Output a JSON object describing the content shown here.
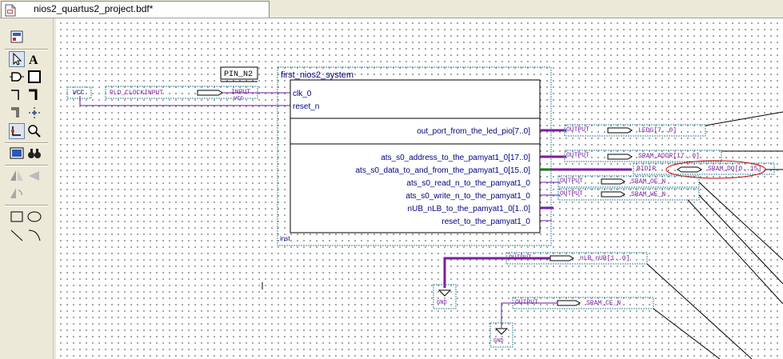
{
  "tab": {
    "title": "nios2_quartus2_project.bdf*",
    "icon": "bdf-file-icon"
  },
  "toolbar": {
    "tools": [
      "float-toolbar-icon",
      "selection-tool-icon",
      "text-tool-icon",
      "symbol-tool-icon",
      "block-tool-icon",
      "orthogonal-node-icon",
      "orthogonal-bus-icon",
      "conduit-icon",
      "rubberbanding-icon",
      "partial-line-select-icon",
      "zoom-icon",
      "full-screen-icon",
      "find-icon",
      "flip-horizontal-icon",
      "flip-vertical-icon",
      "rotate-icon",
      "rectangle-icon",
      "oval-icon",
      "line-icon",
      "arc-icon"
    ]
  },
  "schematic": {
    "vcc": "VCC",
    "clock_pin": "PLD_CLOCKINPUT",
    "input_type": "INPUT",
    "input_std": "VCC",
    "pin_loc": "PIN_N2",
    "system_title": "first_nios2_system",
    "clk": "clk_0",
    "reset": "reset_n",
    "inst": "inst",
    "ports": [
      "out_port_from_the_led_pio[7..0]",
      "ats_s0_address_to_the_pamyat1_0[17..0]",
      "ats_s0_data_to_and_from_the_pamyat1_0[15..0]",
      "ats_s0_read_n_to_the_pamyat1_0",
      "ats_s0_write_n_to_the_pamyat1_0",
      "nUB_nLB_to_the_pamyat1_0[1..0]",
      "reset_to_the_pamyat1_0"
    ],
    "output_label": "OUTPUT",
    "bidir_label": "BIDIR",
    "pins": [
      "LEDG[7..0]",
      "SRAM_ADDR[17..0]",
      "SRAM_DQ[0..15]",
      "SRAM_OE_N",
      "SRAM_WE_N",
      "nLB_nUB[1..0]",
      "SRAM_CE_N"
    ],
    "gnd": "GND"
  },
  "colors": {
    "bus": "#7b1fa2",
    "wire": "#6a1b9a",
    "text": "#000080",
    "pin_border": "#3a8a9a",
    "highlight": "#c00000",
    "bidir_wire": "#1a7a1a"
  }
}
